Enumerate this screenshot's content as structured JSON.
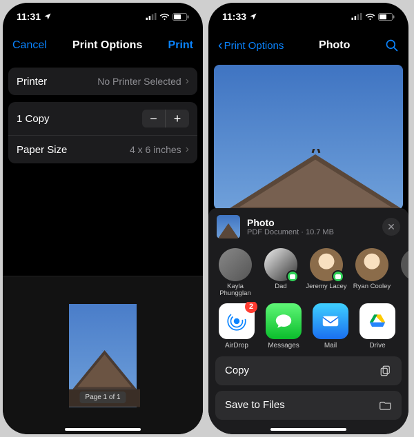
{
  "left": {
    "status": {
      "time": "11:31",
      "loc_icon": "location-arrow"
    },
    "header": {
      "cancel": "Cancel",
      "title": "Print Options",
      "print": "Print"
    },
    "printer_row": {
      "label": "Printer",
      "value": "No Printer Selected"
    },
    "copies_row": {
      "label": "1 Copy"
    },
    "paper_row": {
      "label": "Paper Size",
      "value": "4 x 6 inches"
    },
    "preview": {
      "page_label": "Page 1 of 1"
    }
  },
  "right": {
    "status": {
      "time": "11:33",
      "loc_icon": "location-arrow"
    },
    "header": {
      "back": "Print Options",
      "title": "Photo",
      "search_icon": "search"
    },
    "share_card": {
      "title": "Photo",
      "subtitle": "PDF Document · 10.7 MB",
      "contacts": [
        {
          "name": "Kayla Phungglan"
        },
        {
          "name": "Dad"
        },
        {
          "name": "Jeremy Lacey"
        },
        {
          "name": "Ryan Cooley"
        }
      ],
      "apps": [
        {
          "name": "AirDrop",
          "badge": "2"
        },
        {
          "name": "Messages"
        },
        {
          "name": "Mail"
        },
        {
          "name": "Drive"
        }
      ],
      "actions": {
        "copy": "Copy",
        "save_files": "Save to Files"
      }
    }
  }
}
